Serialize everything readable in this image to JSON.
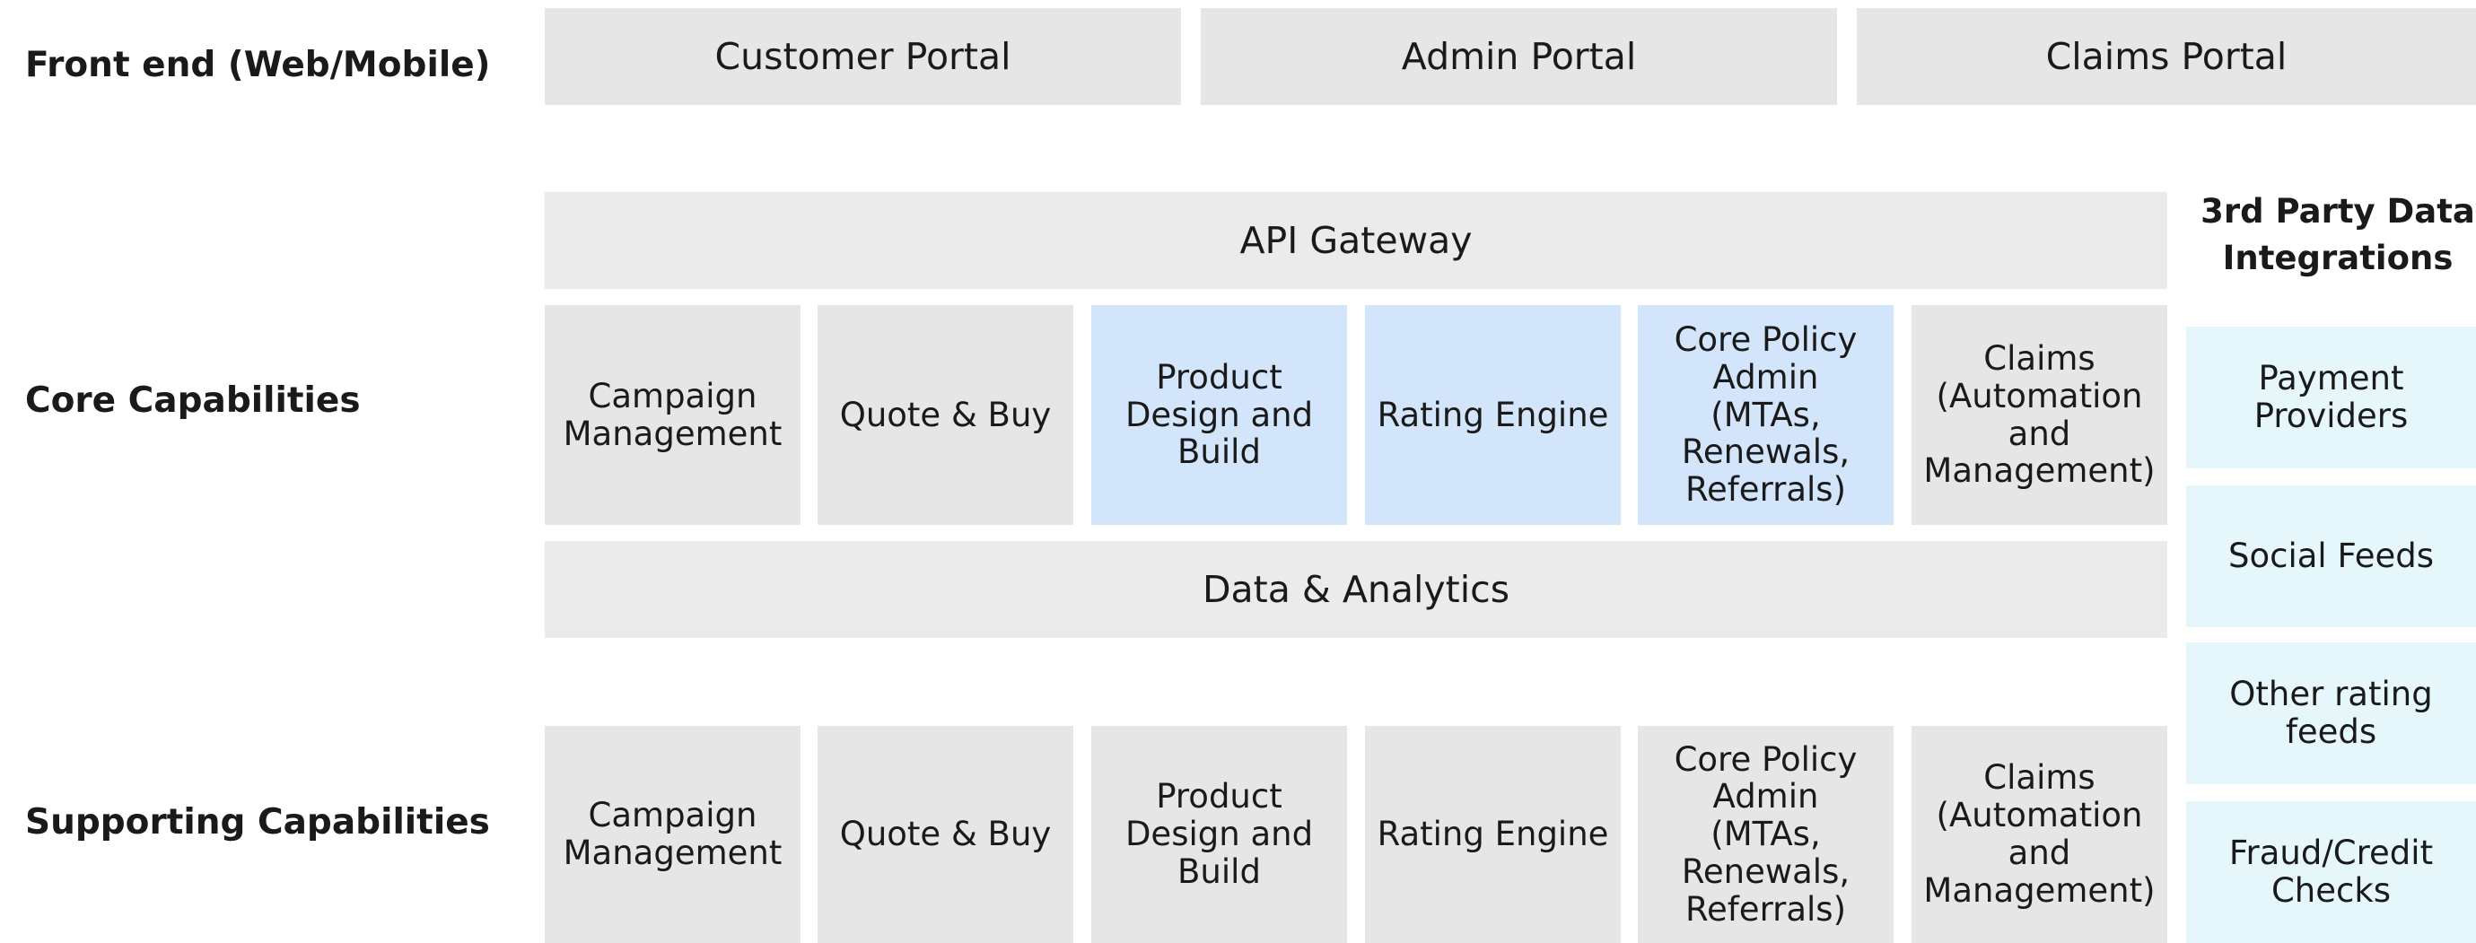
{
  "labels": {
    "frontend": "Front end (Web/Mobile)",
    "core": "Core Capabilities",
    "supporting": "Supporting Capabilities"
  },
  "portals": [
    "Customer Portal",
    "Admin Portal",
    "Claims Portal"
  ],
  "api_gateway": "API Gateway",
  "data_analytics": "Data & Analytics",
  "core_capabilities": [
    "Campaign\nManagement",
    "Quote & Buy",
    "Product\nDesign and\nBuild",
    "Rating Engine",
    "Core Policy\nAdmin\n(MTAs,\nRenewals,\nReferrals)",
    "Claims\n(Automation\nand\nManagement)"
  ],
  "supporting_capabilities": [
    "Campaign\nManagement",
    "Quote & Buy",
    "Product\nDesign and\nBuild",
    "Rating Engine",
    "Core Policy\nAdmin\n(MTAs,\nRenewals,\nReferrals)",
    "Claims\n(Automation\nand\nManagement)"
  ],
  "third_party": {
    "header": "3rd Party Data\nIntegrations",
    "items": [
      "Payment\nProviders",
      "Social Feeds",
      "Other rating\nfeeds",
      "Fraud/Credit\nChecks"
    ]
  },
  "colors": {
    "box_grey": "#e6e6e6",
    "box_blue": "#d3e5fa",
    "box_cyan": "#e6f7fb"
  }
}
